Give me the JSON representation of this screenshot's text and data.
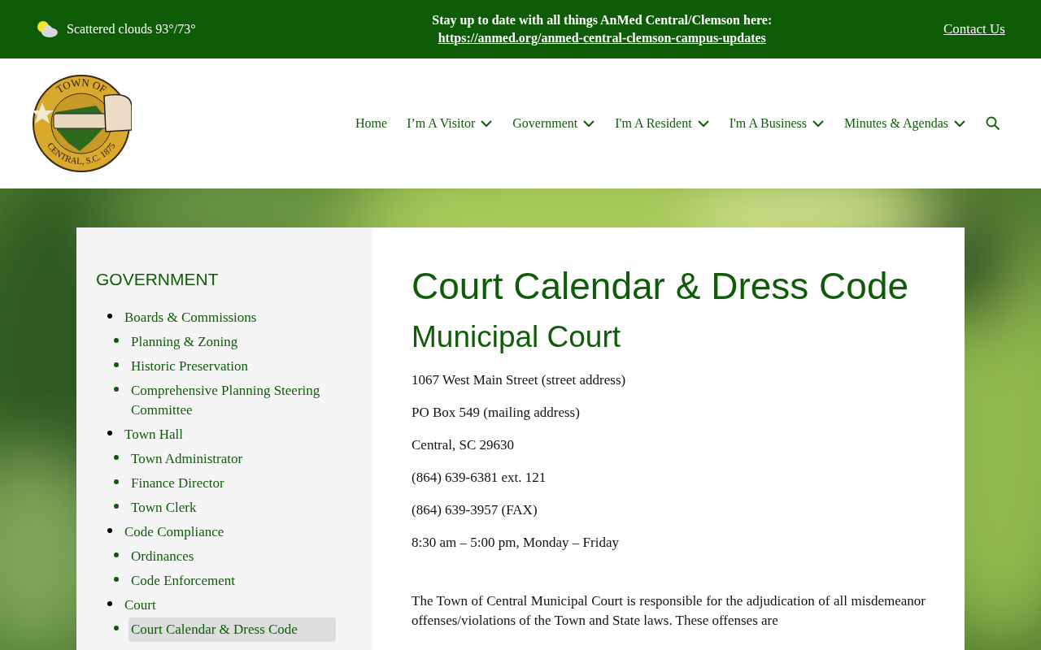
{
  "top_bar": {
    "weather": "Scattered clouds 93°/73°",
    "notice": "Stay up to date with all things AnMed Central/Clemson here:",
    "notice_link": "https://anmed.org/anmed-central-clemson-campus-updates",
    "contact": "Contact Us"
  },
  "logo": {
    "top_text": "TOWN OF",
    "bottom_text": "CENTRAL, S.C. 1875"
  },
  "nav": [
    {
      "label": "Home",
      "dropdown": false
    },
    {
      "label": "I’m A Visitor",
      "dropdown": true
    },
    {
      "label": "Government",
      "dropdown": true
    },
    {
      "label": "I'm A Resident",
      "dropdown": true
    },
    {
      "label": "I'm A Business",
      "dropdown": true
    },
    {
      "label": "Minutes & Agendas",
      "dropdown": true
    }
  ],
  "sidebar": {
    "title": "GOVERNMENT",
    "items": [
      {
        "label": "Boards & Commissions",
        "selected": false,
        "children": [
          {
            "label": "Planning & Zoning",
            "selected": false
          },
          {
            "label": "Historic Preservation",
            "selected": false
          },
          {
            "label": "Comprehensive Planning Steering Committee",
            "selected": false
          }
        ]
      },
      {
        "label": "Town Hall",
        "selected": false,
        "children": [
          {
            "label": "Town Administrator",
            "selected": false
          },
          {
            "label": "Finance Director",
            "selected": false
          },
          {
            "label": "Town Clerk",
            "selected": false
          }
        ]
      },
      {
        "label": "Code Compliance",
        "selected": false,
        "children": [
          {
            "label": "Ordinances",
            "selected": false
          },
          {
            "label": "Code Enforcement",
            "selected": false
          }
        ]
      },
      {
        "label": "Court",
        "selected": false,
        "children": [
          {
            "label": "Court Calendar & Dress Code",
            "selected": true
          }
        ]
      }
    ]
  },
  "content": {
    "title": "Court Calendar & Dress Code",
    "subtitle": "Municipal Court",
    "lines": [
      "1067 West Main Street (street address)",
      "PO Box 549 (mailing address)",
      "Central, SC 29630",
      "(864) 639-6381 ext. 121",
      "(864) 639-3957 (FAX)",
      "8:30 am – 5:00 pm, Monday – Friday"
    ],
    "paragraph": "The Town of Central Municipal Court is responsible for the adjudication of all misdemeanor offenses/violations of the Town and State laws. These offenses are"
  }
}
